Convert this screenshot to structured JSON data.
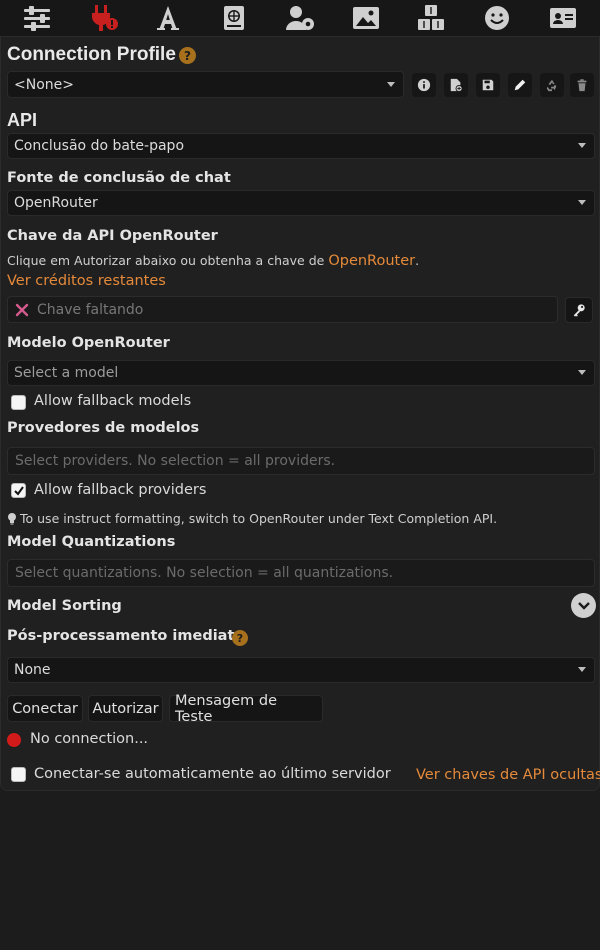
{
  "nav": {
    "icons": [
      "sliders-icon",
      "plug-icon",
      "font-icon",
      "book-globe-icon",
      "user-gear-icon",
      "image-icon",
      "cubes-icon",
      "smiley-icon",
      "id-card-icon"
    ]
  },
  "connection_profile": {
    "title": "Connection Profile",
    "selected": "<None>"
  },
  "api": {
    "label": "API",
    "selected": "Conclusão do bate-papo"
  },
  "chat_source": {
    "label": "Fonte de conclusão de chat",
    "selected": "OpenRouter"
  },
  "api_key": {
    "label": "Chave da API OpenRouter",
    "hint_prefix": "Clique em Autorizar abaixo ou obtenha a chave de",
    "hint_link": "OpenRouter",
    "hint_suffix": ".",
    "credits_link": "Ver créditos restantes",
    "placeholder": "Chave faltando"
  },
  "model": {
    "label": "Modelo OpenRouter",
    "selected": "Select a model",
    "fallback_label": "Allow fallback models",
    "fallback_checked": false
  },
  "providers": {
    "label": "Provedores de modelos",
    "placeholder": "Select providers. No selection = all providers.",
    "fallback_label": "Allow fallback providers",
    "fallback_checked": true,
    "tip": "To use instruct formatting, switch to OpenRouter under Text Completion API."
  },
  "quantizations": {
    "label": "Model Quantizations",
    "placeholder": "Select quantizations. No selection = all quantizations."
  },
  "sorting": {
    "label": "Model Sorting"
  },
  "postprocessing": {
    "label": "Pós-processamento imediato",
    "selected": "None"
  },
  "buttons": {
    "connect": "Conectar",
    "authorize": "Autorizar",
    "test": "Mensagem de Teste"
  },
  "status": {
    "text": "No connection...",
    "color": "#d11b1b"
  },
  "footer": {
    "auto_connect_label": "Conectar-se automaticamente ao último servidor",
    "hidden_keys_link": "Ver chaves de API ocultas"
  },
  "colors": {
    "accent": "#e58a3a",
    "help": "#a6701c",
    "plug_red": "#c8201e"
  }
}
